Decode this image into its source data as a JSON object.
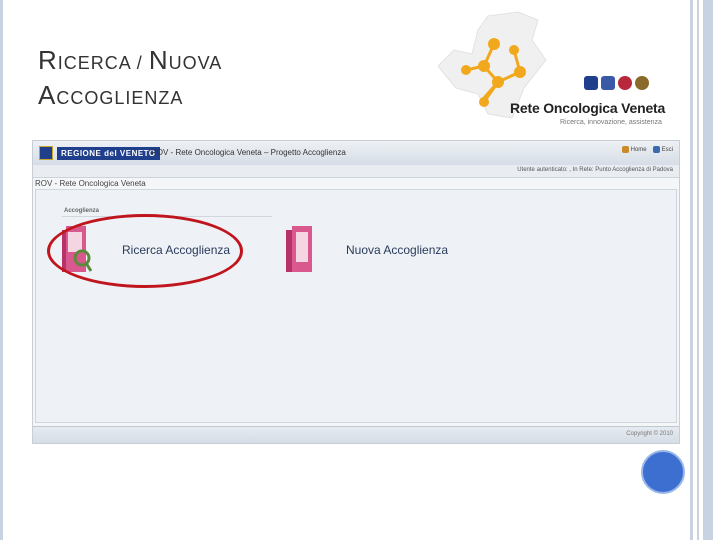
{
  "slide": {
    "title_line1_big": "R",
    "title_line1_small": "ICERCA / ",
    "title_line1_big2": "N",
    "title_line1_small2": "UOVA",
    "title_line2_big": "A",
    "title_line2_small": "CCOGLIENZA"
  },
  "logo": {
    "name": "Rete Oncologica Veneta",
    "tagline": "Ricerca, innovazione, assistenza",
    "color": "#f2a81d"
  },
  "app": {
    "region_label": "REGIONE del VENETO",
    "title": "ROV - Rete Oncologica Veneta – Progetto Accoglienza",
    "links": {
      "home": "Home",
      "exit": "Esci"
    },
    "user_info": "Utente autenticato: , In Rete: Punto Accoglienza di Padova",
    "breadcrumb": "ROV - Rete Oncologica Veneta",
    "section_title": "Accoglienza",
    "tiles": [
      {
        "label": "Ricerca Accoglienza"
      },
      {
        "label": "Nuova Accoglienza"
      }
    ],
    "copyright": "Copyright © 2010"
  },
  "colors": {
    "annotation": "#c0151d",
    "accent_blue": "#3d6fd0",
    "folder_pink": "#d0427a"
  }
}
